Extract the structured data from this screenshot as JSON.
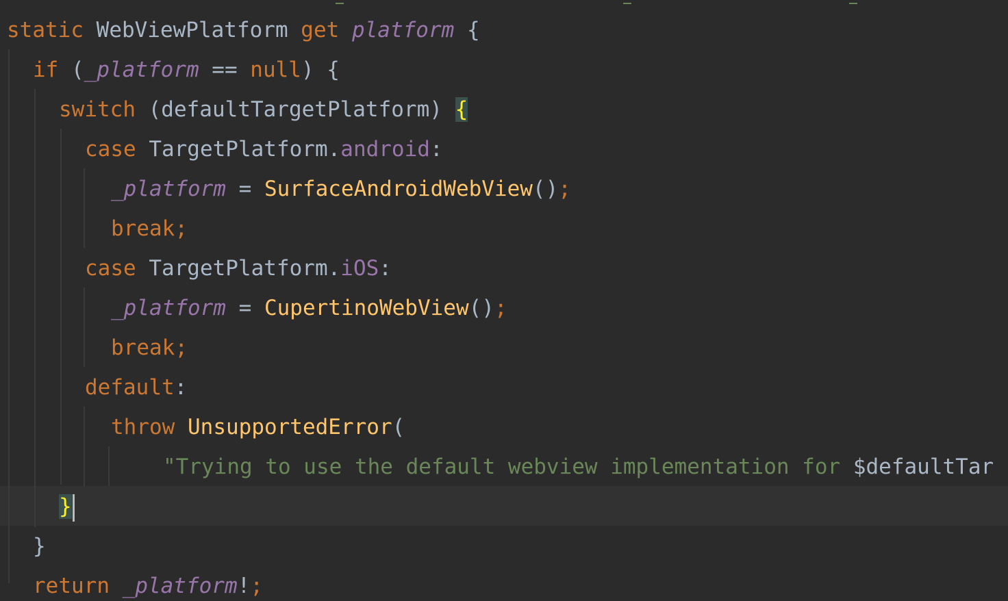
{
  "code": {
    "line1": {
      "kw1": "static",
      "type": "WebViewPlatform",
      "kw2": "get",
      "name": "platform",
      "tail": " {"
    },
    "line2": {
      "kw": "if",
      "open": " (",
      "field": "_platform",
      "op": " == ",
      "null": "null",
      "tail": ") {"
    },
    "line3": {
      "kw": "switch",
      "expr": " (defaultTargetPlatform) ",
      "brace": "{"
    },
    "line4": {
      "kw": "case",
      "cls": " TargetPlatform.",
      "prop": "android",
      "tail": ":"
    },
    "line5": {
      "field": "_platform",
      "op": " = ",
      "fn": "SurfaceAndroidWebView",
      "tail": "()",
      "semi": ";"
    },
    "line6": {
      "kw": "break",
      "semi": ";"
    },
    "line7": {
      "kw": "case",
      "cls": " TargetPlatform.",
      "prop": "iOS",
      "tail": ":"
    },
    "line8": {
      "field": "_platform",
      "op": " = ",
      "fn": "CupertinoWebView",
      "tail": "()",
      "semi": ";"
    },
    "line9": {
      "kw": "break",
      "semi": ";"
    },
    "line10": {
      "kw": "default",
      "tail": ":"
    },
    "line11": {
      "kw": "throw",
      "sp": " ",
      "fn": "UnsupportedError",
      "tail": "("
    },
    "line12": {
      "str": "\"Trying to use the default webview implementation for ",
      "interp": "$defaultTar"
    },
    "line13": {
      "brace": "}"
    },
    "line14": {
      "brace": "}"
    },
    "line15": {
      "kw": "return",
      "sp": " ",
      "field": "_platform",
      "bang": "!",
      "semi": ";"
    }
  },
  "colors": {
    "background": "#2b2b2b",
    "keyword": "#cc7832",
    "function": "#ffc66d",
    "field": "#9876aa",
    "string": "#6a8759",
    "plain": "#a9b7c6",
    "brace_match": "#ffef28"
  }
}
